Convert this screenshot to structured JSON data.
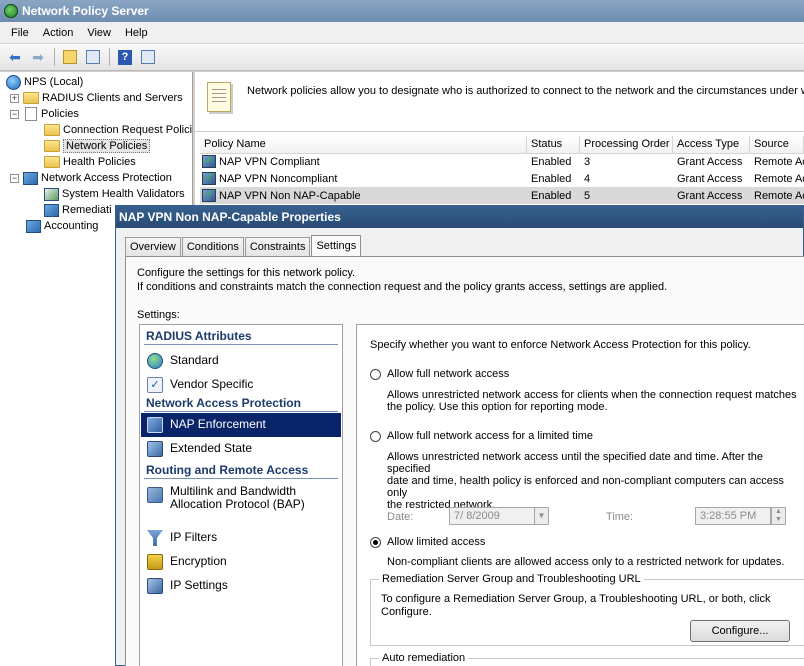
{
  "window": {
    "title": "Network Policy Server"
  },
  "menu": [
    "File",
    "Action",
    "View",
    "Help"
  ],
  "tree": {
    "root": "NPS (Local)",
    "radius_clients": "RADIUS Clients and Servers",
    "policies": "Policies",
    "conn_request": "Connection Request Polici",
    "network_policies": "Network Policies",
    "health_policies": "Health Policies",
    "nap": "Network Access Protection",
    "shv": "System Health Validators",
    "remediation": "Remediati",
    "accounting": "Accounting"
  },
  "banner": {
    "text": "Network policies allow you to designate who is authorized to connect to the network and the circumstances under whi"
  },
  "list": {
    "columns": [
      "Policy Name",
      "Status",
      "Processing Order",
      "Access Type",
      "Source"
    ],
    "rows": [
      {
        "name": "NAP VPN Compliant",
        "status": "Enabled",
        "order": "3",
        "access": "Grant Access",
        "source": "Remote Ac"
      },
      {
        "name": "NAP VPN Noncompliant",
        "status": "Enabled",
        "order": "4",
        "access": "Grant Access",
        "source": "Remote Ac"
      },
      {
        "name": "NAP VPN Non NAP-Capable",
        "status": "Enabled",
        "order": "5",
        "access": "Grant Access",
        "source": "Remote Ac"
      }
    ]
  },
  "dialog": {
    "title": "NAP VPN Non NAP-Capable Properties",
    "tabs": [
      "Overview",
      "Conditions",
      "Constraints",
      "Settings"
    ],
    "desc1": "Configure the settings for this network policy.",
    "desc2": "If conditions and constraints match the connection request and the policy grants access, settings are applied.",
    "settings_label": "Settings:",
    "sections": {
      "radius": "RADIUS Attributes",
      "nap": "Network Access Protection",
      "routing": "Routing and Remote Access"
    },
    "items": {
      "standard": "Standard",
      "vendor": "Vendor Specific",
      "nap_enforcement": "NAP Enforcement",
      "extended_state": "Extended State",
      "multilink_1": "Multilink and Bandwidth",
      "multilink_2": "Allocation Protocol (BAP)",
      "ip_filters": "IP Filters",
      "encryption": "Encryption",
      "ip_settings": "IP Settings"
    },
    "detail": {
      "intro": "Specify whether you want to enforce Network Access Protection for this policy.",
      "opt1": "Allow full network access",
      "opt1_desc_1": "Allows unrestricted network access for clients when the connection request matches",
      "opt1_desc_2": "the policy.  Use this option for reporting mode.",
      "opt2": "Allow full network access for a limited time",
      "opt2_desc_1": "Allows unrestricted network access until the specified date and time. After the specified",
      "opt2_desc_2": "date and time, health policy is enforced and non-compliant computers can access only",
      "opt2_desc_3": "the restricted network.",
      "date_label": "Date:",
      "date_value": "7/  8/2009",
      "time_label": "Time:",
      "time_value": "3:28:55 PM",
      "opt3": "Allow limited access",
      "opt3_desc": "Non-compliant clients are allowed access only to a restricted network for updates.",
      "group_title": "Remediation Server Group and Troubleshooting URL",
      "group_desc_1": "To configure a Remediation Server Group, a Troubleshooting URL, or both, click",
      "group_desc_2": "Configure.",
      "configure_btn": "Configure...",
      "auto_remediation": "Auto remediation"
    }
  }
}
